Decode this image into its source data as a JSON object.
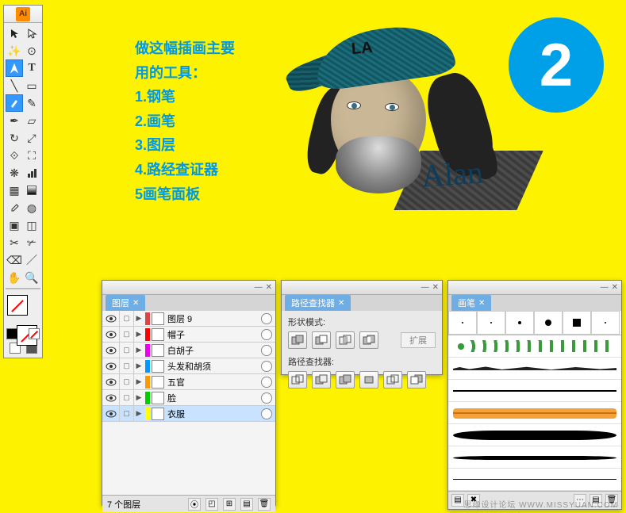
{
  "app": {
    "badge": "Ai"
  },
  "big_number": "2",
  "instructions": {
    "line1": "做这幅插画主要",
    "line2": "用的工具：",
    "item1": "1.钢笔",
    "item2": "2.画笔",
    "item3": "3.图层",
    "item4": "4.路经查证器",
    "item5": "5画笔面板"
  },
  "illustration": {
    "hat_text": "LA",
    "signature": "Alan"
  },
  "toolbox": {
    "tools": [
      "selection",
      "direct-selection",
      "magic-wand",
      "lasso",
      "pen",
      "type",
      "line",
      "rectangle",
      "paintbrush",
      "pencil",
      "blob-brush",
      "eraser",
      "rotate",
      "scale",
      "warp",
      "free-transform",
      "symbol-sprayer",
      "graph",
      "mesh",
      "gradient",
      "eyedropper",
      "blend",
      "live-paint",
      "live-paint-select",
      "slice",
      "crop",
      "scissors",
      "knife",
      "hand",
      "zoom"
    ]
  },
  "layers_panel": {
    "tab": "图层",
    "rows": [
      {
        "name": "图层 9",
        "color": "#d44",
        "selected": false
      },
      {
        "name": "帽子",
        "color": "#f00",
        "selected": false
      },
      {
        "name": "白胡子",
        "color": "#e0e",
        "selected": false
      },
      {
        "name": "头发和胡须",
        "color": "#09f",
        "selected": false
      },
      {
        "name": "五官",
        "color": "#f90",
        "selected": false
      },
      {
        "name": "脸",
        "color": "#0c0",
        "selected": false
      },
      {
        "name": "衣服",
        "color": "#ff0",
        "selected": true
      }
    ],
    "footer_count": "7 个图层"
  },
  "pathfinder_panel": {
    "tab": "路径查找器",
    "shape_modes_label": "形状模式:",
    "pathfinders_label": "路径查找器:",
    "expand": "扩展"
  },
  "brushes_panel": {
    "tab": "画笔"
  },
  "watermark": "思缘设计论坛   WWW.MISSYUAN.COM"
}
